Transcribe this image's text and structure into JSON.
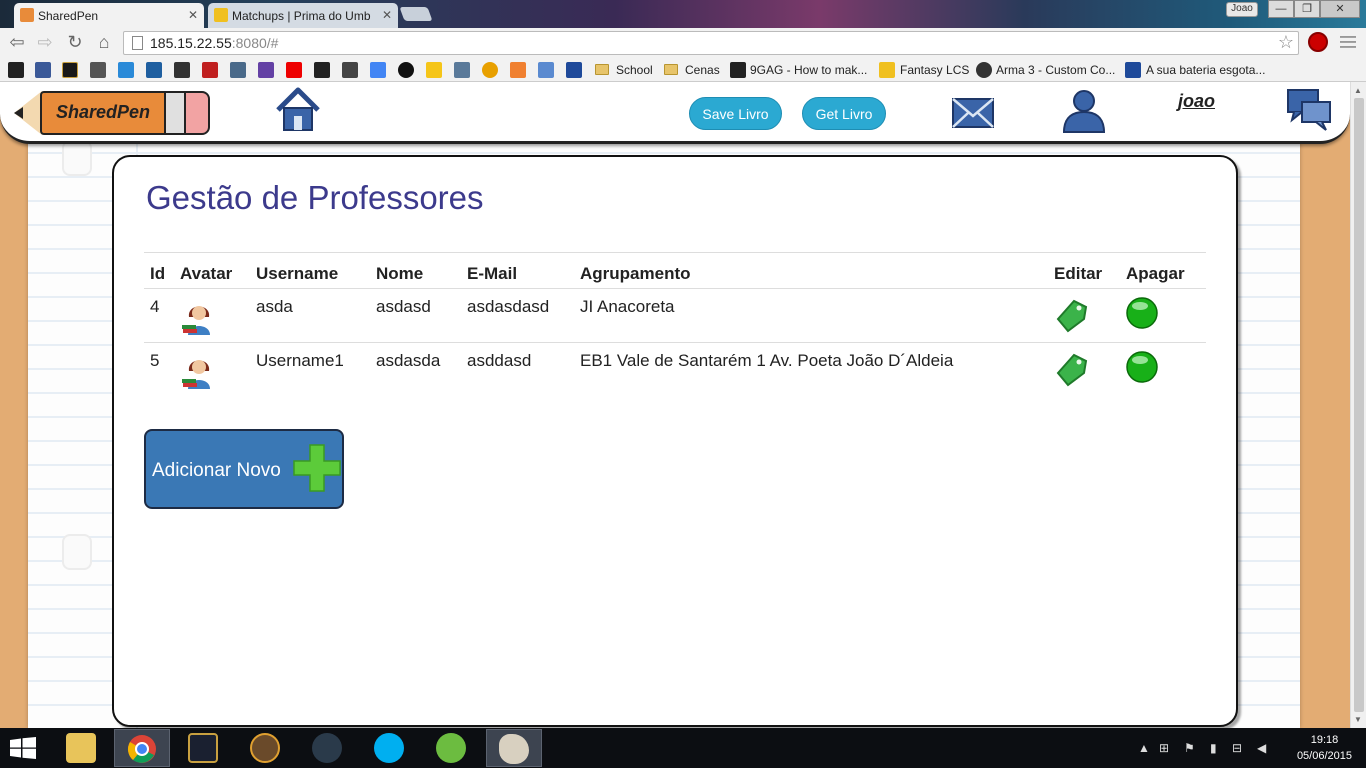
{
  "browser": {
    "tabs": [
      {
        "title": "SharedPen",
        "active": true
      },
      {
        "title": "Matchups | Prima do Umb",
        "active": false
      }
    ],
    "user_chip": "Joao",
    "window_buttons": {
      "minimize": "—",
      "restore": "❐",
      "close": "✕"
    },
    "url_host": "185.15.22.55",
    "url_path": ":8080/#",
    "bookmarks": [
      {
        "label": "School",
        "folder": true
      },
      {
        "label": "Cenas",
        "folder": true
      },
      {
        "label": "9GAG - How to mak...",
        "folder": false
      },
      {
        "label": "Fantasy LCS",
        "folder": false
      },
      {
        "label": "Arma 3 - Custom Co...",
        "folder": false
      },
      {
        "label": "A sua bateria esgota...",
        "folder": false
      }
    ]
  },
  "header": {
    "logo_text": "SharedPen",
    "save_label": "Save Livro",
    "get_label": "Get Livro",
    "username": "joao"
  },
  "main": {
    "title": "Gestão de Professores",
    "columns": [
      "Id",
      "Avatar",
      "Username",
      "Nome",
      "E-Mail",
      "Agrupamento",
      "Editar",
      "Apagar"
    ],
    "rows": [
      {
        "id": "4",
        "username": "asda",
        "nome": "asdasd",
        "email": "asdasdasd",
        "agrupamento": "JI Anacoreta"
      },
      {
        "id": "5",
        "username": "Username1",
        "nome": "asdasda",
        "email": "asddasd",
        "agrupamento": "EB1 Vale de Santarém 1 Av. Poeta João D´Aldeia"
      }
    ],
    "add_label": "Adicionar Novo"
  },
  "taskbar": {
    "time": "19:18",
    "date": "05/06/2015"
  },
  "colors": {
    "title": "#3c3a8c",
    "pill": "#2ba9d2",
    "add_button": "#3a78b5",
    "page_border": "#e3ac73"
  }
}
